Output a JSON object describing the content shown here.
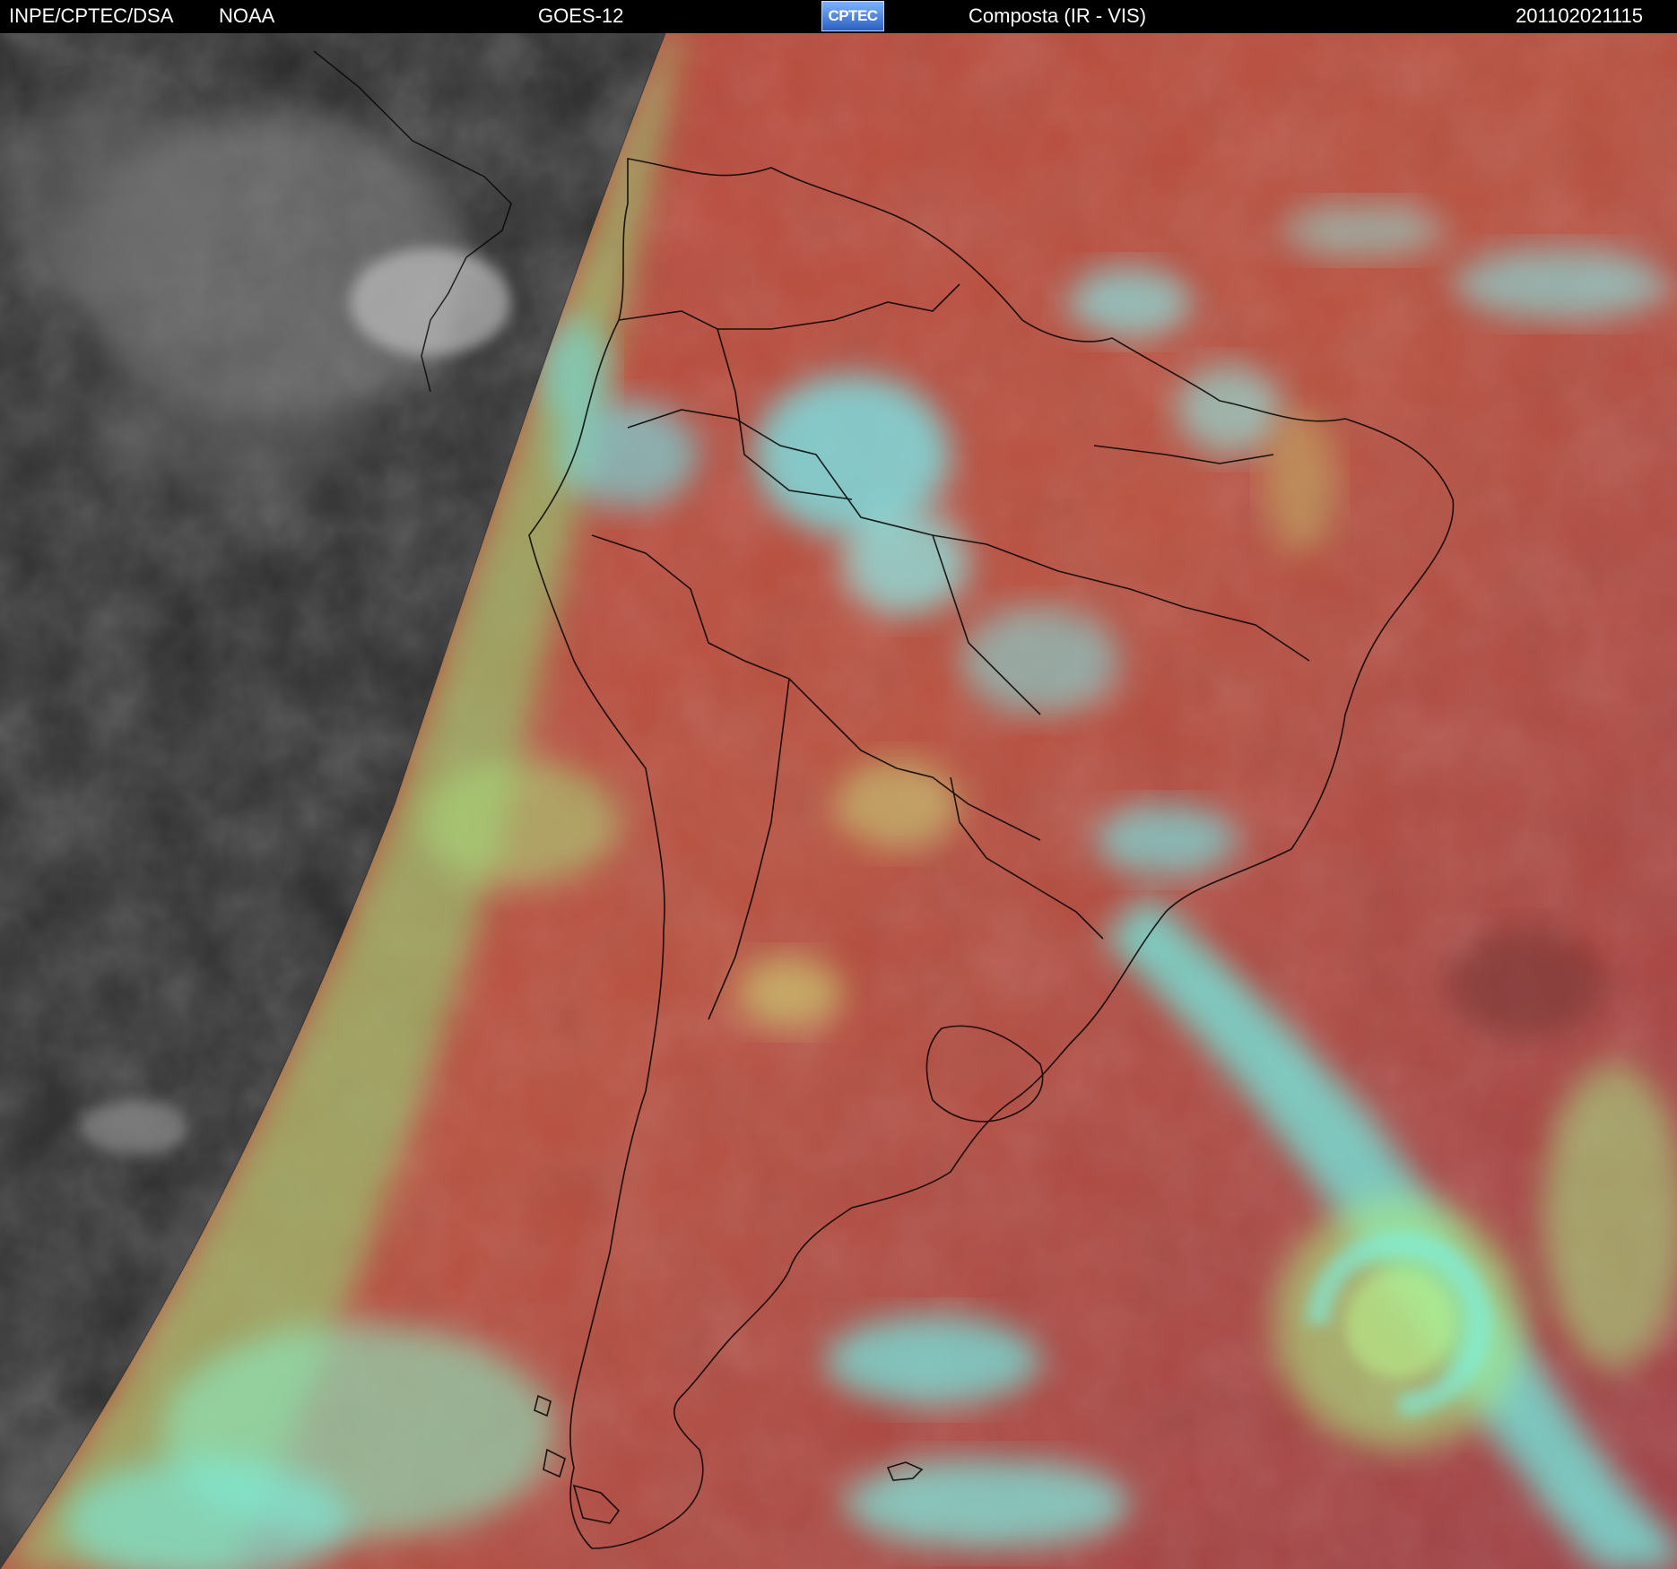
{
  "header": {
    "org": "INPE/CPTEC/DSA",
    "agency": "NOAA",
    "satellite": "GOES-12",
    "logo_text": "CPTEC",
    "product": "Composta (IR - VIS)",
    "timestamp": "201102021115"
  },
  "colors": {
    "night_side": "#2a2a2a",
    "ocean_day": "#b5473d",
    "land_day": "#a94a3f",
    "cloud_cyan": "#6ff0ee",
    "cloud_green": "#9ff07a",
    "coastline": "#000000"
  }
}
